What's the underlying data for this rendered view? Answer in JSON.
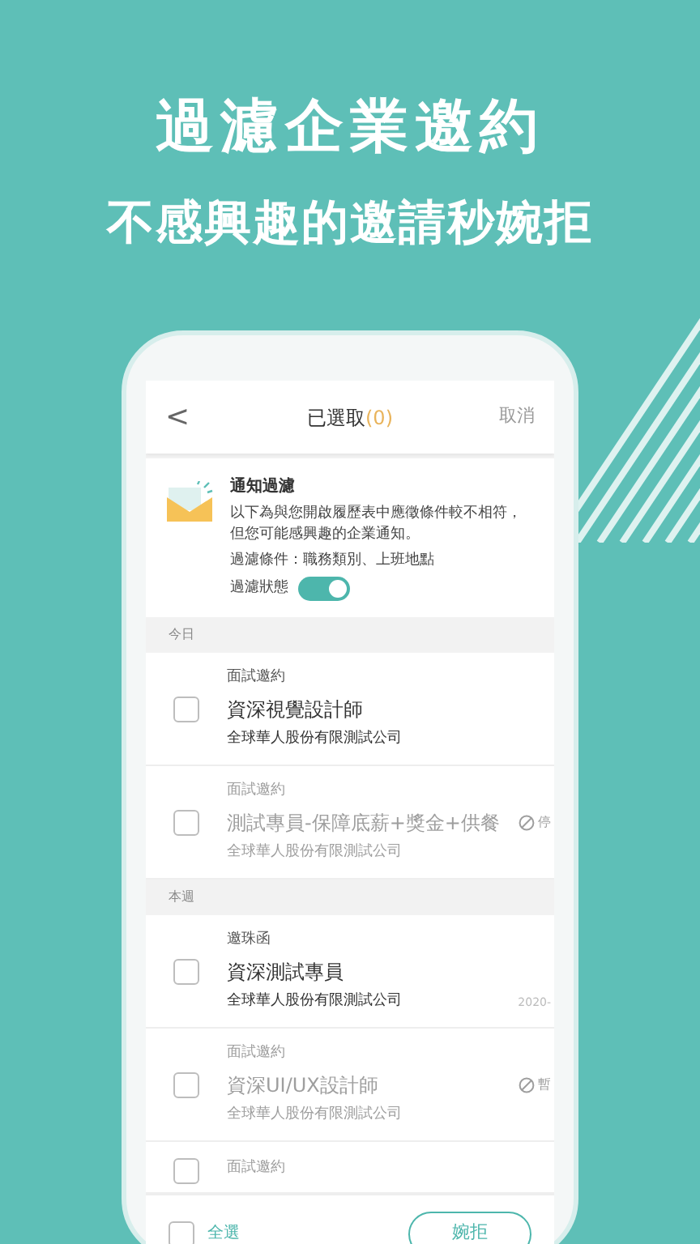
{
  "headline": {
    "title": "過濾企業邀約",
    "subtitle": "不感興趣的邀請秒婉拒"
  },
  "header": {
    "back": "<",
    "title": "已選取",
    "count": "(0)",
    "cancel": "取消"
  },
  "notice": {
    "title": "通知過濾",
    "body": "以下為與您開啟履歷表中應徵條件較不相符，但您可能感興趣的企業通知。",
    "conditions": "過濾條件：職務類別、上班地點",
    "toggle_label": "過濾狀態",
    "on": true
  },
  "sections": [
    {
      "label": "今日",
      "items": [
        {
          "type": "面試邀約",
          "title": "資深視覺設計師",
          "company": "全球華人股份有限測試公司",
          "dimmed": false,
          "checked": false
        },
        {
          "type": "面試邀約",
          "title": "測試專員-保障底薪+獎金+供餐",
          "company": "全球華人股份有限測試公司",
          "dimmed": true,
          "checked": false,
          "side": "停",
          "kind": "status"
        }
      ]
    },
    {
      "label": "本週",
      "items": [
        {
          "type": "邀珠函",
          "title": "資深測試專員",
          "company": "全球華人股份有限測試公司",
          "dimmed": false,
          "checked": false,
          "side": "2020-",
          "kind": "date"
        },
        {
          "type": "面試邀約",
          "title": "資深UI/UX設計師",
          "company": "全球華人股份有限測試公司",
          "dimmed": true,
          "checked": false,
          "side": "暫",
          "kind": "status"
        },
        {
          "type": "面試邀約",
          "dimmed": true,
          "checked": false
        }
      ]
    }
  ],
  "footer": {
    "select_all": "全選",
    "checked": false,
    "decline": "婉拒"
  }
}
